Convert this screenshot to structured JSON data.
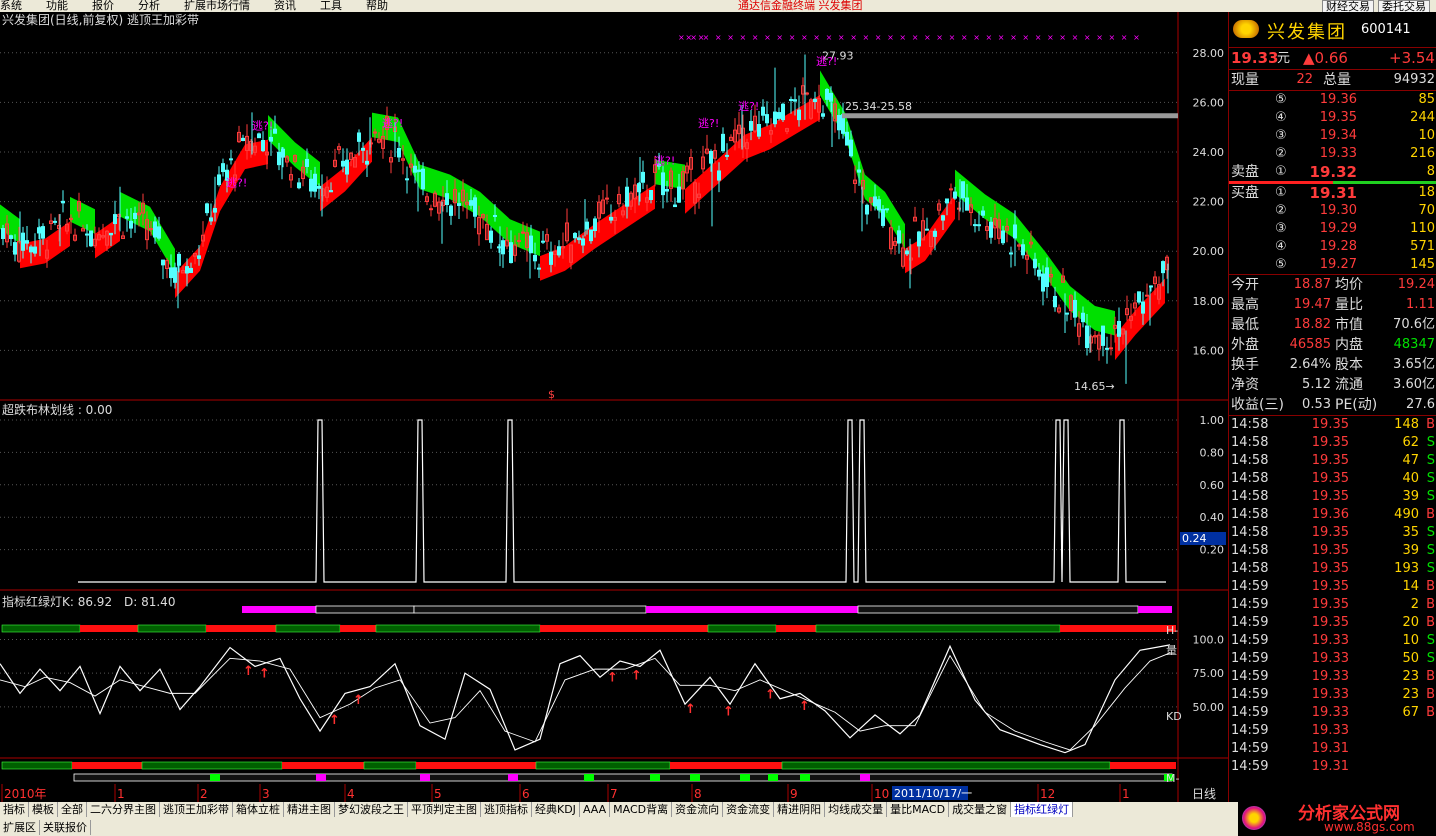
{
  "menu": {
    "items": [
      "系统",
      "功能",
      "报价",
      "分析",
      "扩展市场行情",
      "资讯",
      "工具",
      "帮助"
    ],
    "center_title": "通达信金融终端  兴发集团",
    "right_buttons": [
      "财经交易",
      "委托交易"
    ]
  },
  "main_chart": {
    "title": "兴发集团(日线,前复权) 逃顶王加彩带",
    "y_ticks": [
      "28.00",
      "26.00",
      "24.00",
      "22.00",
      "20.00",
      "18.00",
      "16.00"
    ],
    "y_range": [
      14.0,
      29.0
    ],
    "annotations": {
      "high": "27.93",
      "low": "14.65→",
      "range": "25.34-25.58",
      "escape": "逃?!",
      "dollar": "$"
    },
    "escape_labels_at": [
      [
        262,
        24.9
      ],
      [
        392,
        25.0
      ],
      [
        236,
        22.6
      ],
      [
        664,
        23.5
      ],
      [
        708,
        25.0
      ],
      [
        748,
        25.7
      ],
      [
        826,
        27.5
      ]
    ],
    "trend": [
      [
        0,
        20.9
      ],
      [
        20,
        20.3
      ],
      [
        45,
        20.5
      ],
      [
        70,
        21.2
      ],
      [
        95,
        20.7
      ],
      [
        120,
        21.4
      ],
      [
        150,
        20.8
      ],
      [
        175,
        19.1
      ],
      [
        200,
        20.2
      ],
      [
        220,
        22.6
      ],
      [
        245,
        24.3
      ],
      [
        268,
        24.5
      ],
      [
        295,
        23.4
      ],
      [
        320,
        22.6
      ],
      [
        345,
        23.4
      ],
      [
        372,
        24.6
      ],
      [
        398,
        24.4
      ],
      [
        420,
        22.5
      ],
      [
        450,
        22.1
      ],
      [
        480,
        21.4
      ],
      [
        510,
        20.3
      ],
      [
        540,
        19.8
      ],
      [
        565,
        20.2
      ],
      [
        595,
        21.1
      ],
      [
        625,
        21.9
      ],
      [
        655,
        22.7
      ],
      [
        685,
        22.5
      ],
      [
        715,
        23.6
      ],
      [
        745,
        24.7
      ],
      [
        770,
        25.1
      ],
      [
        795,
        25.7
      ],
      [
        820,
        26.3
      ],
      [
        845,
        24.6
      ],
      [
        865,
        22.1
      ],
      [
        885,
        21.4
      ],
      [
        905,
        20.1
      ],
      [
        925,
        20.6
      ],
      [
        955,
        22.3
      ],
      [
        985,
        21.3
      ],
      [
        1015,
        20.5
      ],
      [
        1045,
        19.0
      ],
      [
        1070,
        17.6
      ],
      [
        1095,
        16.8
      ],
      [
        1115,
        16.6
      ],
      [
        1135,
        17.6
      ],
      [
        1165,
        18.9
      ]
    ],
    "candles_sample": [
      [
        20,
        21.0,
        21.6,
        20.4
      ],
      [
        40,
        20.3,
        21.0,
        19.8
      ],
      [
        60,
        20.8,
        21.5,
        20.2
      ],
      [
        120,
        21.5,
        22.6,
        20.8
      ],
      [
        178,
        18.8,
        19.6,
        17.7
      ],
      [
        215,
        22.0,
        23.0,
        21.2
      ],
      [
        252,
        24.8,
        25.6,
        23.9
      ],
      [
        282,
        23.7,
        24.2,
        22.9
      ],
      [
        322,
        22.3,
        23.1,
        21.4
      ],
      [
        370,
        24.5,
        25.4,
        23.9
      ],
      [
        395,
        24.6,
        25.2,
        23.8
      ],
      [
        418,
        22.4,
        23.2,
        21.6
      ],
      [
        442,
        21.2,
        22.0,
        20.3
      ],
      [
        500,
        20.1,
        21.0,
        19.4
      ],
      [
        530,
        19.6,
        20.5,
        18.9
      ],
      [
        585,
        21.3,
        22.1,
        20.6
      ],
      [
        640,
        22.6,
        23.8,
        22.0
      ],
      [
        712,
        22.5,
        23.8,
        21.0
      ],
      [
        742,
        25.0,
        25.9,
        24.1
      ],
      [
        775,
        26.2,
        27.4,
        25.0
      ],
      [
        805,
        26.6,
        27.93,
        25.3
      ],
      [
        832,
        25.4,
        26.0,
        24.2
      ],
      [
        862,
        21.7,
        22.6,
        20.8
      ],
      [
        910,
        19.3,
        20.5,
        18.5
      ],
      [
        960,
        22.5,
        22.9,
        21.6
      ],
      [
        1015,
        20.2,
        20.9,
        19.4
      ],
      [
        1065,
        17.3,
        18.3,
        16.7
      ],
      [
        1090,
        16.4,
        17.0,
        15.9
      ],
      [
        1126,
        15.6,
        16.8,
        14.65
      ],
      [
        1150,
        17.7,
        18.6,
        17.0
      ],
      [
        1168,
        18.9,
        19.5,
        18.3
      ]
    ]
  },
  "mid_chart": {
    "title": "超跌布林划线 : 0.00",
    "y_ticks": [
      "1.00",
      "0.80",
      "0.60",
      "0.40",
      "0.20"
    ],
    "value_box": "0.24",
    "y_range": [
      0,
      1.0
    ],
    "x_range": [
      78,
      1166
    ],
    "spikes": [
      320,
      420,
      510,
      850,
      862,
      1058,
      1066,
      1122
    ]
  },
  "kd_chart": {
    "title": "指标红绿灯",
    "k_label": "K: 86.92",
    "d_label": "D: 81.40",
    "y_ticks": [
      "100.0",
      "75.00",
      "50.00"
    ],
    "y_range": [
      15,
      110
    ],
    "right_labels": [
      "H-",
      "量",
      "KD",
      "M-"
    ],
    "k_series": [
      [
        0,
        82
      ],
      [
        20,
        60
      ],
      [
        40,
        78
      ],
      [
        60,
        62
      ],
      [
        80,
        80
      ],
      [
        100,
        45
      ],
      [
        120,
        80
      ],
      [
        140,
        62
      ],
      [
        160,
        78
      ],
      [
        180,
        48
      ],
      [
        200,
        65
      ],
      [
        230,
        94
      ],
      [
        255,
        80
      ],
      [
        280,
        86
      ],
      [
        300,
        56
      ],
      [
        320,
        32
      ],
      [
        345,
        60
      ],
      [
        370,
        65
      ],
      [
        395,
        82
      ],
      [
        420,
        36
      ],
      [
        445,
        26
      ],
      [
        465,
        75
      ],
      [
        490,
        63
      ],
      [
        515,
        18
      ],
      [
        540,
        26
      ],
      [
        560,
        82
      ],
      [
        580,
        88
      ],
      [
        600,
        72
      ],
      [
        620,
        84
      ],
      [
        640,
        80
      ],
      [
        660,
        92
      ],
      [
        685,
        52
      ],
      [
        710,
        72
      ],
      [
        730,
        52
      ],
      [
        755,
        82
      ],
      [
        780,
        56
      ],
      [
        800,
        60
      ],
      [
        825,
        47
      ],
      [
        850,
        27
      ],
      [
        875,
        44
      ],
      [
        900,
        30
      ],
      [
        920,
        44
      ],
      [
        950,
        95
      ],
      [
        975,
        55
      ],
      [
        1000,
        33
      ],
      [
        1040,
        22
      ],
      [
        1065,
        16
      ],
      [
        1085,
        22
      ],
      [
        1115,
        70
      ],
      [
        1140,
        92
      ],
      [
        1170,
        96
      ]
    ],
    "d_series": [
      [
        0,
        70
      ],
      [
        25,
        65
      ],
      [
        45,
        72
      ],
      [
        70,
        68
      ],
      [
        95,
        58
      ],
      [
        120,
        70
      ],
      [
        145,
        65
      ],
      [
        170,
        60
      ],
      [
        195,
        60
      ],
      [
        230,
        86
      ],
      [
        260,
        84
      ],
      [
        290,
        78
      ],
      [
        320,
        42
      ],
      [
        350,
        52
      ],
      [
        375,
        64
      ],
      [
        400,
        70
      ],
      [
        430,
        38
      ],
      [
        455,
        42
      ],
      [
        480,
        62
      ],
      [
        505,
        32
      ],
      [
        535,
        24
      ],
      [
        565,
        70
      ],
      [
        595,
        78
      ],
      [
        625,
        78
      ],
      [
        655,
        86
      ],
      [
        680,
        66
      ],
      [
        710,
        66
      ],
      [
        735,
        62
      ],
      [
        760,
        70
      ],
      [
        785,
        62
      ],
      [
        810,
        54
      ],
      [
        835,
        46
      ],
      [
        860,
        32
      ],
      [
        885,
        36
      ],
      [
        915,
        36
      ],
      [
        950,
        88
      ],
      [
        985,
        46
      ],
      [
        1015,
        32
      ],
      [
        1045,
        24
      ],
      [
        1070,
        18
      ],
      [
        1095,
        36
      ],
      [
        1125,
        64
      ],
      [
        1150,
        84
      ],
      [
        1170,
        90
      ]
    ],
    "up_arrows": [
      248,
      264,
      334,
      358,
      612,
      636,
      690,
      728,
      770,
      804
    ]
  },
  "x_axis": {
    "labels": [
      [
        "2010年",
        2
      ],
      [
        "1",
        115
      ],
      [
        "2",
        198
      ],
      [
        "3",
        260
      ],
      [
        "4",
        345
      ],
      [
        "5",
        432
      ],
      [
        "6",
        520
      ],
      [
        "7",
        608
      ],
      [
        "8",
        692
      ],
      [
        "9",
        788
      ],
      [
        "10",
        872
      ],
      [
        "12",
        1038
      ],
      [
        "1",
        1120
      ]
    ],
    "highlight": "2011/10/17/一",
    "period": "日线"
  },
  "quote": {
    "name": "兴发集团",
    "code": "600141",
    "price": "19.33",
    "price_unit": "元",
    "change": "▲0.66",
    "change_pct": "+3.54",
    "xianliang_label": "现量",
    "xianliang": "22",
    "zongliang_label": "总量",
    "zongliang": "94932",
    "sell_label": "卖盘",
    "buy_label": "买盘",
    "sell": [
      {
        "lvl": "⑤",
        "price": "19.36",
        "vol": "85"
      },
      {
        "lvl": "④",
        "price": "19.35",
        "vol": "244"
      },
      {
        "lvl": "③",
        "price": "19.34",
        "vol": "10"
      },
      {
        "lvl": "②",
        "price": "19.33",
        "vol": "216"
      },
      {
        "lvl": "①",
        "price": "19.32",
        "vol": "8"
      }
    ],
    "buy": [
      {
        "lvl": "①",
        "price": "19.31",
        "vol": "18"
      },
      {
        "lvl": "②",
        "price": "19.30",
        "vol": "70"
      },
      {
        "lvl": "③",
        "price": "19.29",
        "vol": "110"
      },
      {
        "lvl": "④",
        "price": "19.28",
        "vol": "571"
      },
      {
        "lvl": "⑤",
        "price": "19.27",
        "vol": "145"
      }
    ],
    "stats": [
      [
        {
          "l": "今开",
          "v": "18.87",
          "vc": "r"
        },
        {
          "l": "均价",
          "v": "19.24",
          "vc": "r"
        }
      ],
      [
        {
          "l": "最高",
          "v": "19.47",
          "vc": "r"
        },
        {
          "l": "量比",
          "v": "1.11",
          "vc": "r"
        }
      ],
      [
        {
          "l": "最低",
          "v": "18.82",
          "vc": "r"
        },
        {
          "l": "市值",
          "v": "70.6亿",
          "vc": "w"
        }
      ],
      [
        {
          "l": "外盘",
          "v": "46585",
          "vc": "r"
        },
        {
          "l": "内盘",
          "v": "48347",
          "vc": "g"
        }
      ],
      [
        {
          "l": "换手",
          "v": "2.64%",
          "vc": "w"
        },
        {
          "l": "股本",
          "v": "3.65亿",
          "vc": "w"
        }
      ],
      [
        {
          "l": "净资",
          "v": "5.12",
          "vc": "w"
        },
        {
          "l": "流通",
          "v": "3.60亿",
          "vc": "w"
        }
      ],
      [
        {
          "l": "收益(三)",
          "v": "0.53",
          "vc": "w"
        },
        {
          "l": "PE(动)",
          "v": "27.6",
          "vc": "w"
        }
      ]
    ],
    "ticks": [
      {
        "t": "14:58",
        "p": "19.35",
        "v": "148",
        "d": "B"
      },
      {
        "t": "14:58",
        "p": "19.35",
        "v": "62",
        "d": "S"
      },
      {
        "t": "14:58",
        "p": "19.35",
        "v": "47",
        "d": "S"
      },
      {
        "t": "14:58",
        "p": "19.35",
        "v": "40",
        "d": "S"
      },
      {
        "t": "14:58",
        "p": "19.35",
        "v": "39",
        "d": "S"
      },
      {
        "t": "14:58",
        "p": "19.36",
        "v": "490",
        "d": "B"
      },
      {
        "t": "14:58",
        "p": "19.35",
        "v": "35",
        "d": "S"
      },
      {
        "t": "14:58",
        "p": "19.35",
        "v": "39",
        "d": "S"
      },
      {
        "t": "14:58",
        "p": "19.35",
        "v": "193",
        "d": "S"
      },
      {
        "t": "14:59",
        "p": "19.35",
        "v": "14",
        "d": "B"
      },
      {
        "t": "14:59",
        "p": "19.35",
        "v": "2",
        "d": "B"
      },
      {
        "t": "14:59",
        "p": "19.35",
        "v": "20",
        "d": "B"
      },
      {
        "t": "14:59",
        "p": "19.33",
        "v": "10",
        "d": "S"
      },
      {
        "t": "14:59",
        "p": "19.33",
        "v": "50",
        "d": "S"
      },
      {
        "t": "14:59",
        "p": "19.33",
        "v": "23",
        "d": "B"
      },
      {
        "t": "14:59",
        "p": "19.33",
        "v": "23",
        "d": "B"
      },
      {
        "t": "14:59",
        "p": "19.33",
        "v": "67",
        "d": "B"
      },
      {
        "t": "14:59",
        "p": "19.33",
        "v": "",
        "d": ""
      },
      {
        "t": "14:59",
        "p": "19.31",
        "v": "",
        "d": ""
      },
      {
        "t": "14:59",
        "p": "19.31",
        "v": "",
        "d": ""
      }
    ]
  },
  "tabs": {
    "items": [
      "指标",
      "模板",
      "全部",
      "二六分界主图",
      "逃顶王加彩带",
      "箱体立桩",
      "精进主图",
      "梦幻波段之王",
      "平顶判定主图",
      "逃顶指标",
      "经典KDJ",
      "AAA",
      "MACD背离",
      "资金流向",
      "资金流变",
      "精进阴阳",
      "均线成交量",
      "量比MACD",
      "成交量之窗",
      "指标红绿灯"
    ],
    "active_index": 19,
    "second_row": [
      "扩展区",
      "关联报价"
    ]
  },
  "brand": {
    "text": "分析家公式网",
    "url_text": "www.88gs.com"
  },
  "colors": {
    "up": "#ff3b3b",
    "down": "#00e000",
    "band_up": "#ff0000",
    "band_down": "#00e000",
    "magenta": "#ff00ff",
    "axis": "#aa0000",
    "grid": "#555555"
  }
}
